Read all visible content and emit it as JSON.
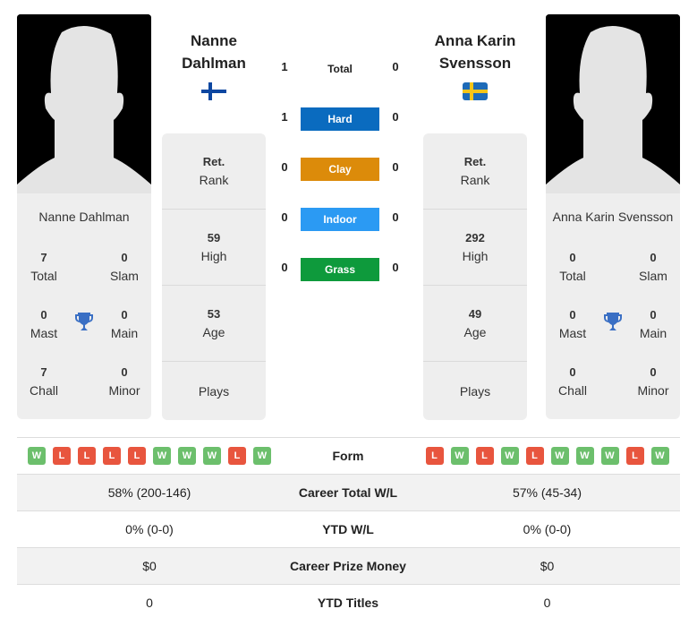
{
  "player1": {
    "name": "Nanne Dahlman",
    "name_line1": "Nanne",
    "name_line2": "Dahlman",
    "flag": "finland-flag",
    "titles": {
      "total": "7",
      "total_label": "Total",
      "slam": "0",
      "slam_label": "Slam",
      "mast": "0",
      "mast_label": "Mast",
      "main": "0",
      "main_label": "Main",
      "chall": "7",
      "chall_label": "Chall",
      "minor": "0",
      "minor_label": "Minor"
    },
    "rank": {
      "value": "Ret.",
      "label": "Rank"
    },
    "high": {
      "value": "59",
      "label": "High"
    },
    "age": {
      "value": "53",
      "label": "Age"
    },
    "plays": {
      "value": "",
      "label": "Plays"
    },
    "form": [
      "W",
      "L",
      "L",
      "L",
      "L",
      "W",
      "W",
      "W",
      "L",
      "W"
    ],
    "career_total_wl": "58% (200-146)",
    "ytd_wl": "0% (0-0)",
    "career_prize_money": "$0",
    "ytd_titles": "0"
  },
  "player2": {
    "name": "Anna Karin Svensson",
    "name_line1": "Anna Karin",
    "name_line2": "Svensson",
    "flag": "sweden-flag",
    "titles": {
      "total": "0",
      "total_label": "Total",
      "slam": "0",
      "slam_label": "Slam",
      "mast": "0",
      "mast_label": "Mast",
      "main": "0",
      "main_label": "Main",
      "chall": "0",
      "chall_label": "Chall",
      "minor": "0",
      "minor_label": "Minor"
    },
    "rank": {
      "value": "Ret.",
      "label": "Rank"
    },
    "high": {
      "value": "292",
      "label": "High"
    },
    "age": {
      "value": "49",
      "label": "Age"
    },
    "plays": {
      "value": "",
      "label": "Plays"
    },
    "form": [
      "L",
      "W",
      "L",
      "W",
      "L",
      "W",
      "W",
      "W",
      "L",
      "W"
    ],
    "career_total_wl": "57% (45-34)",
    "ytd_wl": "0% (0-0)",
    "career_prize_money": "$0",
    "ytd_titles": "0"
  },
  "h2h": [
    {
      "label": "Total",
      "p1": "1",
      "p2": "0",
      "color": ""
    },
    {
      "label": "Hard",
      "p1": "1",
      "p2": "0",
      "color": "#0a6bbf"
    },
    {
      "label": "Clay",
      "p1": "0",
      "p2": "0",
      "color": "#dc8b0a"
    },
    {
      "label": "Indoor",
      "p1": "0",
      "p2": "0",
      "color": "#2b9af3"
    },
    {
      "label": "Grass",
      "p1": "0",
      "p2": "0",
      "color": "#0e9a3c"
    }
  ],
  "table_labels": {
    "form": "Form",
    "career_total_wl": "Career Total W/L",
    "ytd_wl": "YTD W/L",
    "career_prize_money": "Career Prize Money",
    "ytd_titles": "YTD Titles"
  },
  "colors": {
    "win": "#6cbf6c",
    "loss": "#e8553e",
    "card_bg": "#eeeeee",
    "trophy": "#3a6fc4"
  }
}
